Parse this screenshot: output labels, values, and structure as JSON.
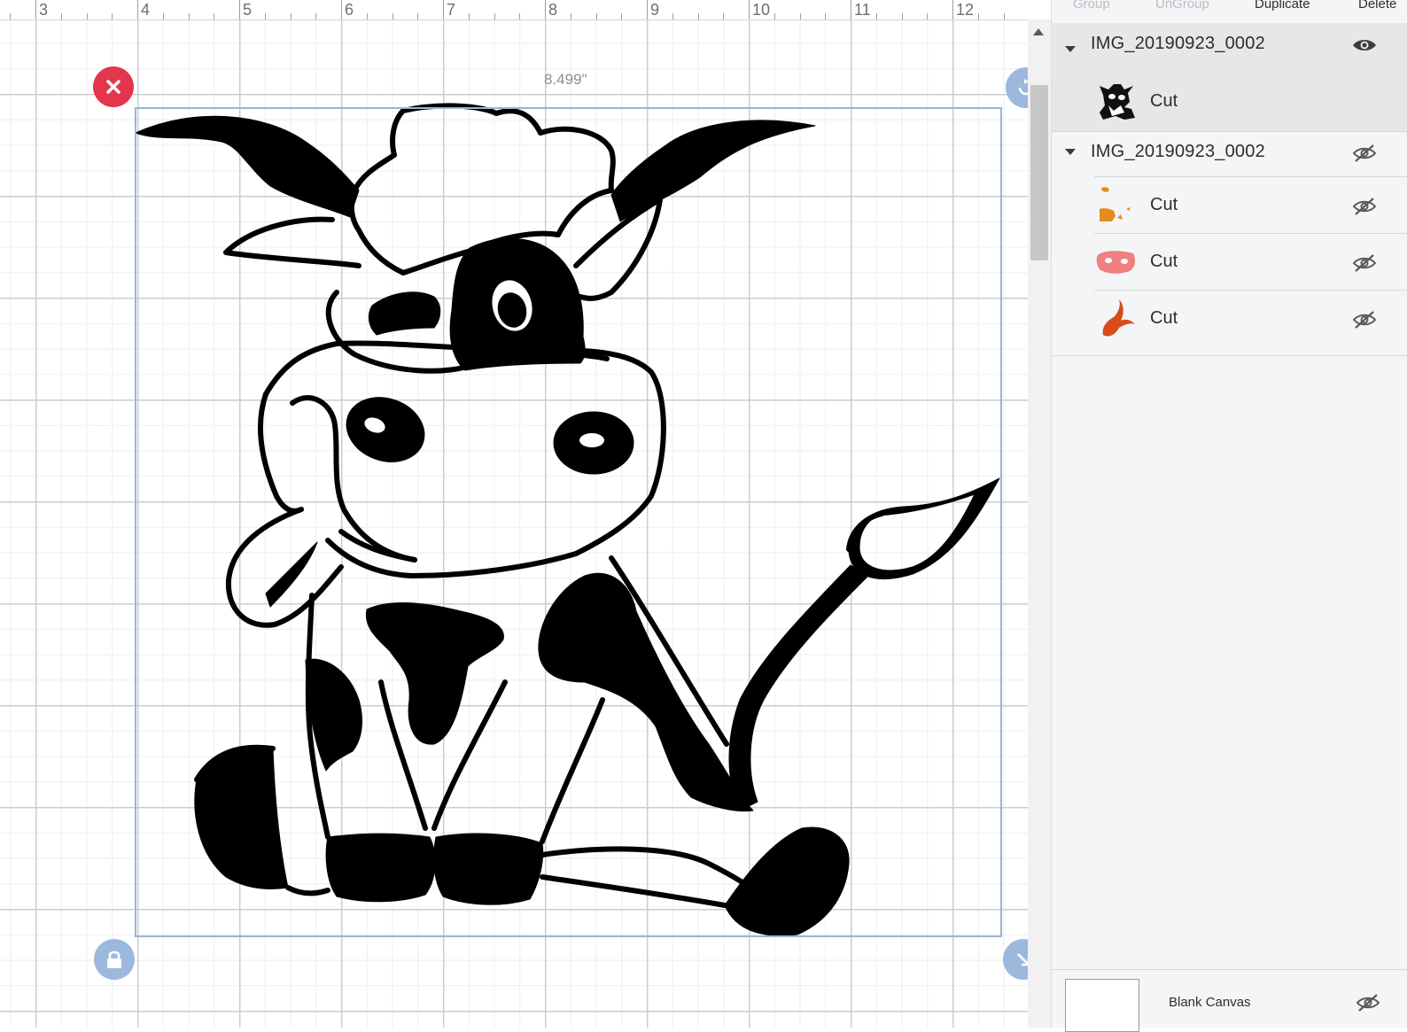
{
  "ruler": {
    "numbers": [
      "3",
      "4",
      "5",
      "6",
      "7",
      "8",
      "9",
      "10",
      "11",
      "12"
    ]
  },
  "canvas": {
    "width_label": "8.499\"",
    "icons": {
      "delete": "close-icon",
      "lock": "lock-icon",
      "rotate": "rotate-icon",
      "resize": "resize-icon"
    }
  },
  "toolbar": {
    "group_label": "Group",
    "ungroup_label": "UnGroup",
    "duplicate_label": "Duplicate",
    "delete_label": "Delete"
  },
  "layers": {
    "groups": [
      {
        "title": "IMG_20190923_0002",
        "visible": true,
        "selected": true,
        "items": [
          {
            "label": "Cut",
            "color": "#111111"
          }
        ]
      },
      {
        "title": "IMG_20190923_0002",
        "visible": false,
        "selected": false,
        "items": [
          {
            "label": "Cut",
            "color": "#e58a1c"
          },
          {
            "label": "Cut",
            "color": "#f07f7f"
          },
          {
            "label": "Cut",
            "color": "#d94b1a"
          }
        ]
      }
    ],
    "blank_canvas": {
      "label": "Blank Canvas",
      "visible": false
    }
  },
  "colors": {
    "selection": "#9bb3d3",
    "delete": "#e3364d",
    "handle": "#9cb8dc",
    "panel_bg": "#f4f5f7",
    "selected_row": "#e6e7e9"
  }
}
